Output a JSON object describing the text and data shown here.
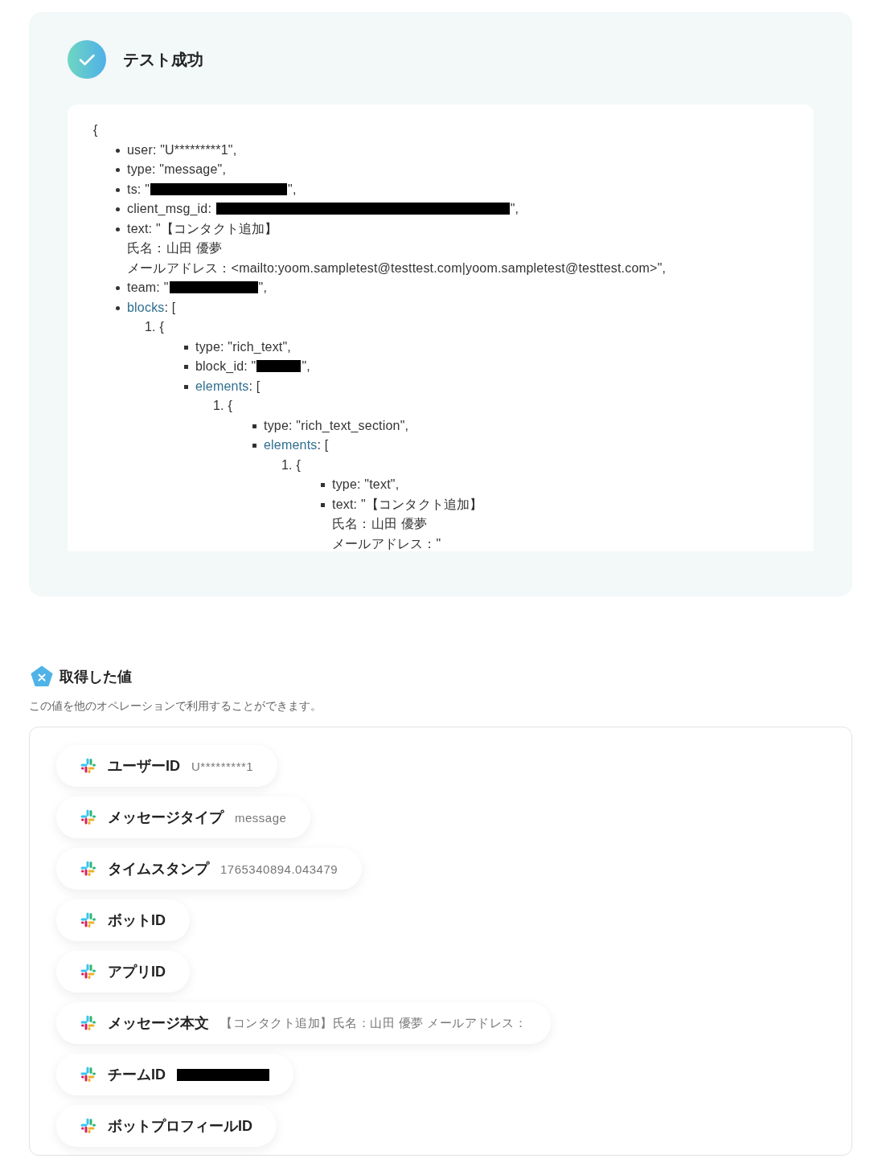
{
  "result_card": {
    "succeeded": true,
    "title": "テスト成功",
    "open_brace": "{",
    "items": [
      {
        "kind": "value",
        "lines": [
          "user: \"U*********1\","
        ]
      },
      {
        "kind": "value",
        "lines": [
          "type: \"message\","
        ]
      },
      {
        "kind": "redacted",
        "before": "ts: \"",
        "redacted": true,
        "after": "\","
      },
      {
        "kind": "redacted",
        "before": "client_msg_id: ",
        "redacted": true,
        "after": "\","
      },
      {
        "kind": "value",
        "lines": [
          "text: \"【コンタクト追加】",
          "氏名：山田 優夢",
          "メールアドレス：<mailto:yoom.sampletest@testtest.com|yoom.sampletest@testtest.com>\","
        ]
      },
      {
        "kind": "redacted",
        "before": "team: \"",
        "redacted": true,
        "after": "\","
      },
      {
        "kind": "array",
        "key": "blocks",
        "after": ": [",
        "entries": [
          {
            "label": "1. {",
            "items": [
              {
                "kind": "value",
                "lines": [
                  "type: \"rich_text\","
                ]
              },
              {
                "kind": "redacted",
                "before": "block_id: \"",
                "redacted": true,
                "after": "\","
              },
              {
                "kind": "array",
                "key": "elements",
                "after": ": [",
                "entries": [
                  {
                    "label": "1. {",
                    "items": [
                      {
                        "kind": "value",
                        "lines": [
                          "type: \"rich_text_section\","
                        ]
                      },
                      {
                        "kind": "array",
                        "key": "elements",
                        "after": ": [",
                        "entries": [
                          {
                            "label": "1. {",
                            "items": [
                              {
                                "kind": "value",
                                "lines": [
                                  "type: \"text\","
                                ]
                              },
                              {
                                "kind": "value",
                                "lines": [
                                  "text: \"【コンタクト追加】",
                                  "氏名：山田 優夢",
                                  "メールアドレス：\""
                                ]
                              }
                            ]
                          }
                        ]
                      }
                    ]
                  }
                ]
              }
            ]
          }
        ]
      }
    ]
  },
  "values_section": {
    "title": "取得した値",
    "description": "この値を他のオペレーションで利用することができます。",
    "chips": [
      {
        "label": "ユーザーID",
        "value": "U*********1"
      },
      {
        "label": "メッセージタイプ",
        "value": "message"
      },
      {
        "label": "タイムスタンプ",
        "value": "1765340894.043479"
      },
      {
        "label": "ボットID"
      },
      {
        "label": "アプリID"
      },
      {
        "label": "メッセージ本文",
        "value": "【コンタクト追加】氏名：山田 優夢 メールアドレス："
      },
      {
        "label": "チームID",
        "redacted": true
      },
      {
        "label": "ボットプロフィールID"
      }
    ]
  }
}
